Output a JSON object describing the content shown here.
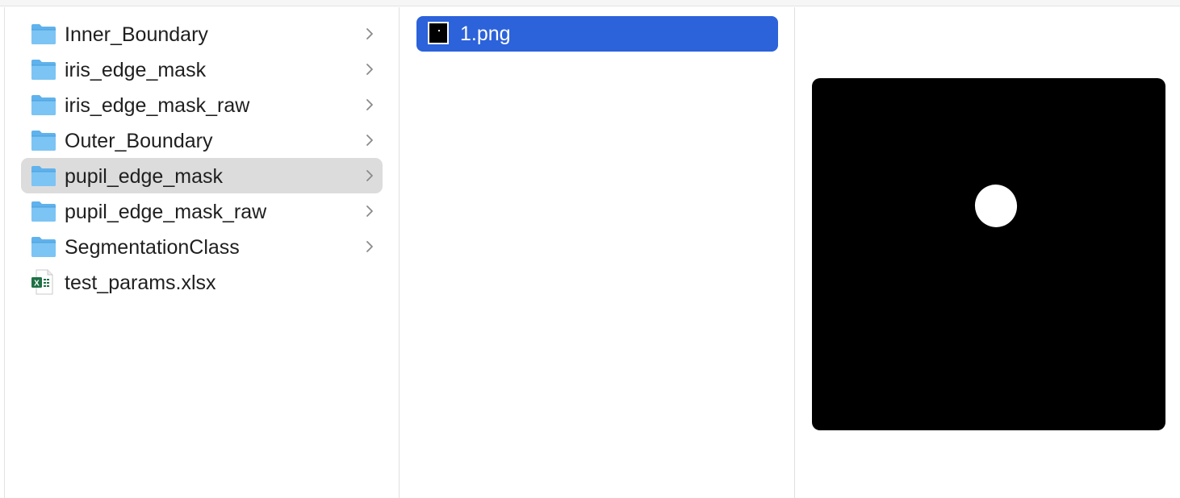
{
  "window": {
    "view": "column-view"
  },
  "column1": {
    "items": [
      {
        "label": "Inner_Boundary",
        "kind": "folder",
        "icon": "folder-icon"
      },
      {
        "label": "iris_edge_mask",
        "kind": "folder",
        "icon": "folder-icon"
      },
      {
        "label": "iris_edge_mask_raw",
        "kind": "folder",
        "icon": "folder-icon"
      },
      {
        "label": "Outer_Boundary",
        "kind": "folder",
        "icon": "folder-icon"
      },
      {
        "label": "pupil_edge_mask",
        "kind": "folder",
        "icon": "folder-icon",
        "selected": true
      },
      {
        "label": "pupil_edge_mask_raw",
        "kind": "folder",
        "icon": "folder-icon"
      },
      {
        "label": "SegmentationClass",
        "kind": "folder",
        "icon": "folder-icon"
      },
      {
        "label": "test_params.xlsx",
        "kind": "file",
        "icon": "excel-file-icon"
      }
    ]
  },
  "column2": {
    "items": [
      {
        "label": "1.png",
        "kind": "image",
        "icon": "png-thumbnail-icon",
        "selected": true
      }
    ]
  },
  "preview": {
    "subject": "binary pupil mask",
    "background_color": "#000000",
    "foreground_color": "#ffffff"
  },
  "colors": {
    "selection_active": "#2c62da",
    "selection_inactive": "#dcdcdc",
    "folder": "#5fb2ec"
  }
}
